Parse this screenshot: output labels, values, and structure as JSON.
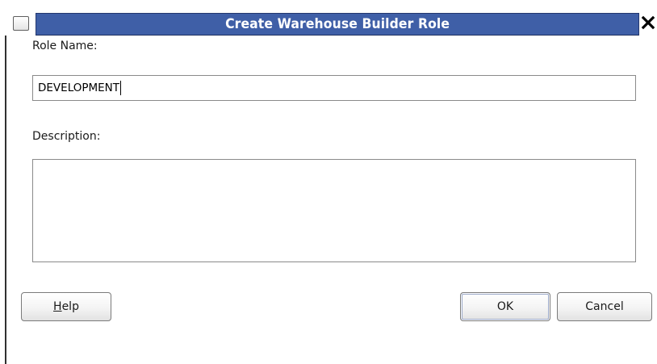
{
  "window": {
    "title": "Create Warehouse Builder Role",
    "close_glyph": "✕",
    "title_bar_color": "#3f5fa7"
  },
  "form": {
    "role_name_label": "Role Name:",
    "role_name_value": "DEVELOPMENT",
    "description_label": "Description:",
    "description_value": ""
  },
  "buttons": {
    "help": {
      "mnemonic": "H",
      "rest": "elp"
    },
    "ok": "OK",
    "cancel": "Cancel"
  },
  "icons": {
    "system_menu": "window-menu-icon",
    "close": "close-icon"
  }
}
